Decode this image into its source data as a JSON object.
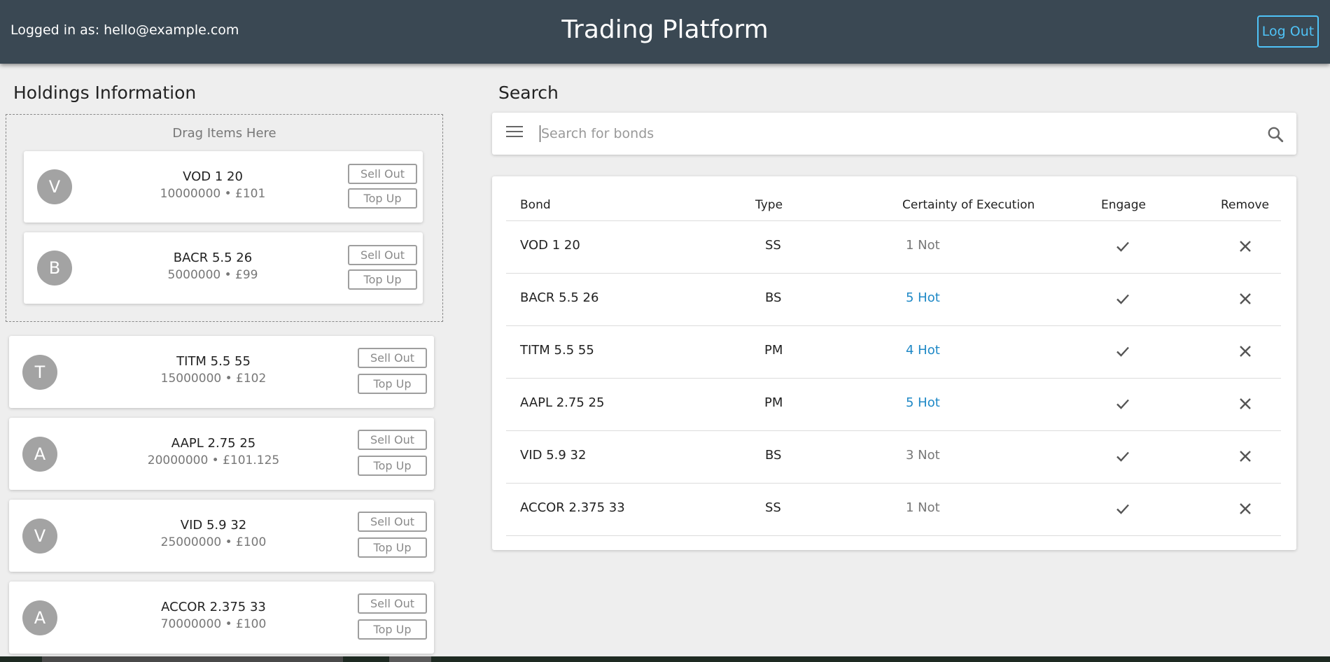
{
  "header": {
    "user_label": "Logged in as: hello@example.com",
    "title": "Trading Platform",
    "logout_label": "Log Out"
  },
  "holdings": {
    "title": "Holdings Information",
    "drop_hint": "Drag Items Here",
    "sell_label": "Sell Out",
    "topup_label": "Top Up",
    "dropped": [
      {
        "initial": "V",
        "name": "VOD 1 20",
        "detail": "10000000 • £101"
      },
      {
        "initial": "B",
        "name": "BACR 5.5 26",
        "detail": "5000000 • £99"
      }
    ],
    "items": [
      {
        "initial": "T",
        "name": "TITM 5.5 55",
        "detail": "15000000 • £102"
      },
      {
        "initial": "A",
        "name": "AAPL 2.75 25",
        "detail": "20000000 • £101.125"
      },
      {
        "initial": "V",
        "name": "VID 5.9 32",
        "detail": "25000000 • £100"
      },
      {
        "initial": "A",
        "name": "ACCOR 2.375 33",
        "detail": "70000000 • £100"
      }
    ]
  },
  "search": {
    "title": "Search",
    "placeholder": "Search for bonds",
    "value": ""
  },
  "table": {
    "columns": [
      "Bond",
      "Type",
      "Certainty of Execution",
      "Engage",
      "Remove"
    ],
    "rows": [
      {
        "bond": "VOD 1 20",
        "type": "SS",
        "certainty": "1 Not",
        "hot": false
      },
      {
        "bond": "BACR 5.5 26",
        "type": "BS",
        "certainty": "5 Hot",
        "hot": true
      },
      {
        "bond": "TITM 5.5 55",
        "type": "PM",
        "certainty": "4 Hot",
        "hot": true
      },
      {
        "bond": "AAPL 2.75 25",
        "type": "PM",
        "certainty": "5 Hot",
        "hot": true
      },
      {
        "bond": "VID 5.9 32",
        "type": "BS",
        "certainty": "3 Not",
        "hot": false
      },
      {
        "bond": "ACCOR 2.375 33",
        "type": "SS",
        "certainty": "1 Not",
        "hot": false
      }
    ],
    "engage_icon": "check-icon",
    "remove_icon": "close-icon"
  },
  "colors": {
    "header_bg": "#3a4853",
    "accent": "#4fc3f7",
    "hot": "#1e88c6",
    "avatar": "#a3a3a3"
  }
}
